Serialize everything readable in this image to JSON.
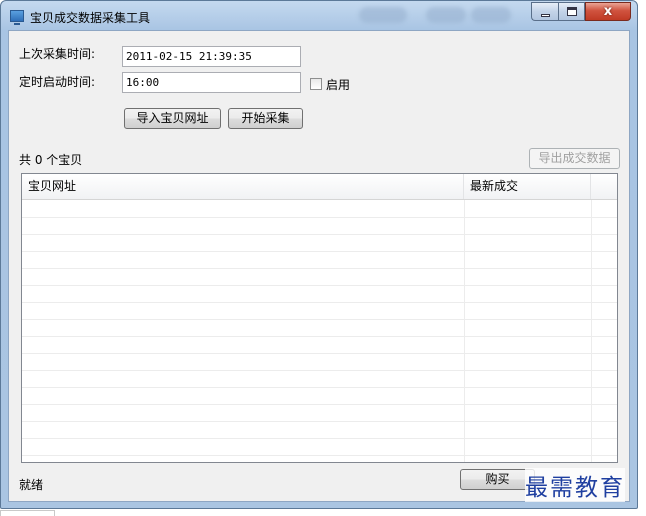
{
  "window": {
    "title": "宝贝成交数据采集工具",
    "close_glyph": "x"
  },
  "form": {
    "last_collect_label": "上次采集时间:",
    "last_collect_value": "2011-02-15 21:39:35",
    "schedule_label": "定时启动时间:",
    "schedule_value": "16:00",
    "enable_label": "启用",
    "enable_checked": false
  },
  "toolbar": {
    "import_label": "导入宝贝网址",
    "start_label": "开始采集",
    "export_label": "导出成交数据"
  },
  "summary": {
    "count_text": "共 0 个宝贝"
  },
  "table": {
    "columns": [
      "宝贝网址",
      "最新成交",
      ""
    ],
    "rows": []
  },
  "status": {
    "text": "就绪",
    "buy_label": "购买"
  },
  "watermark": "最需教育",
  "colors": {
    "title_bar": "#aac5e2",
    "client_bg": "#f0f0f0",
    "close_button": "#c03a25",
    "watermark": "#1f3fa0"
  }
}
